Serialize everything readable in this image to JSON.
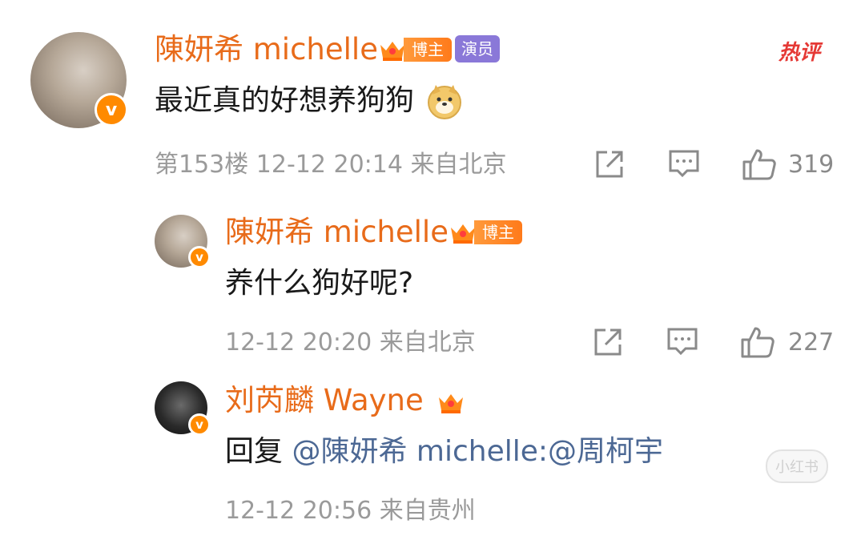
{
  "comment": {
    "author": "陳妍希 michelle",
    "bozhu_badge": "博主",
    "role_badge": "演员",
    "hot_label": "热评",
    "text": "最近真的好想养狗狗",
    "meta": "第153楼 12-12 20:14 来自北京",
    "likes": "319",
    "emoji_icon": "doge-emoji-icon"
  },
  "replies": [
    {
      "author": "陳妍希 michelle",
      "bozhu_badge": "博主",
      "text": "养什么狗好呢?",
      "meta": "12-12 20:20 来自北京",
      "likes": "227"
    },
    {
      "author": "刘芮麟 Wayne",
      "reply_prefix": "回复 ",
      "mention": "@陳妍希 michelle:@周柯宇",
      "meta": "12-12 20:56 来自贵州"
    }
  ],
  "watermark": "小红书",
  "colors": {
    "name": "#e86b1a",
    "text": "#1a1a1a",
    "meta": "#9a9a9a",
    "mention": "#4c6894",
    "verified": "#ff8a00",
    "hot": "#e53935",
    "actor_badge": "#8a78d8"
  }
}
